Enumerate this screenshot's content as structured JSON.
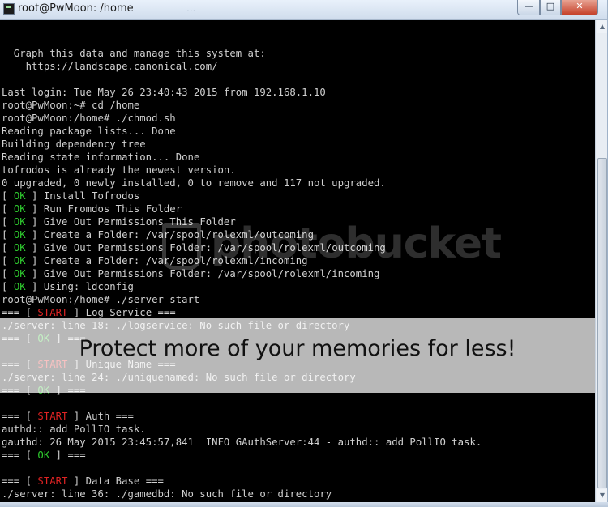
{
  "window": {
    "title": "root@PwMoon: /home",
    "title_ghost": "...",
    "buttons": {
      "minimize": "—",
      "maximize": "□",
      "close": "✕"
    }
  },
  "terminal": {
    "lines": [
      {
        "t": ""
      },
      {
        "t": "  Graph this data and manage this system at:"
      },
      {
        "t": "    https://landscape.canonical.com/"
      },
      {
        "t": ""
      },
      {
        "t": "Last login: Tue May 26 23:40:43 2015 from 192.168.1.10"
      },
      {
        "t": "root@PwMoon:~# cd /home"
      },
      {
        "t": "root@PwMoon:/home# ./chmod.sh"
      },
      {
        "t": "Reading package lists... Done"
      },
      {
        "t": "Building dependency tree"
      },
      {
        "t": "Reading state information... Done"
      },
      {
        "t": "tofrodos is already the newest version."
      },
      {
        "t": "0 upgraded, 0 newly installed, 0 to remove and 117 not upgraded."
      },
      {
        "pre": "[ ",
        "tag": "OK",
        "cls": "ok",
        "post": " ] Install Tofrodos"
      },
      {
        "pre": "[ ",
        "tag": "OK",
        "cls": "ok",
        "post": " ] Run Fromdos This Folder"
      },
      {
        "pre": "[ ",
        "tag": "OK",
        "cls": "ok",
        "post": " ] Give Out Permissions This Folder"
      },
      {
        "pre": "[ ",
        "tag": "OK",
        "cls": "ok",
        "post": " ] Create a Folder: /var/spool/rolexml/outcoming"
      },
      {
        "pre": "[ ",
        "tag": "OK",
        "cls": "ok",
        "post": " ] Give Out Permissions Folder: /var/spool/rolexml/outcoming"
      },
      {
        "pre": "[ ",
        "tag": "OK",
        "cls": "ok",
        "post": " ] Create a Folder: /var/spool/rolexml/incoming"
      },
      {
        "pre": "[ ",
        "tag": "OK",
        "cls": "ok",
        "post": " ] Give Out Permissions Folder: /var/spool/rolexml/incoming"
      },
      {
        "pre": "[ ",
        "tag": "OK",
        "cls": "ok",
        "post": " ] Using: ldconfig"
      },
      {
        "t": "root@PwMoon:/home# ./server start"
      },
      {
        "pre": "=== [ ",
        "tag": "START",
        "cls": "start",
        "post": " ] Log Service ==="
      },
      {
        "t": "./server: line 18: ./logservice: No such file or directory"
      },
      {
        "pre": "=== [ ",
        "tag": "OK",
        "cls": "ok",
        "post": " ] ==="
      },
      {
        "t": ""
      },
      {
        "pre": "=== [ ",
        "tag": "START",
        "cls": "start",
        "post": " ] Unique Name ==="
      },
      {
        "t": "./server: line 24: ./uniquenamed: No such file or directory"
      },
      {
        "pre": "=== [ ",
        "tag": "OK",
        "cls": "ok",
        "post": " ] ==="
      },
      {
        "t": ""
      },
      {
        "pre": "=== [ ",
        "tag": "START",
        "cls": "start",
        "post": " ] Auth ==="
      },
      {
        "t": "authd:: add PollIO task."
      },
      {
        "t": "gauthd: 26 May 2015 23:45:57,841  INFO GAuthServer:44 - authd:: add PollIO task."
      },
      {
        "pre": "=== [ ",
        "tag": "OK",
        "cls": "ok",
        "post": " ] ==="
      },
      {
        "t": ""
      },
      {
        "pre": "=== [ ",
        "tag": "START",
        "cls": "start",
        "post": " ] Data Base ==="
      },
      {
        "t": "./server: line 36: ./gamedbd: No such file or directory"
      },
      {
        "cursor": true
      }
    ]
  },
  "watermark": {
    "logo_text": "photobucket",
    "banner_text": "Protect more of your memories for less!"
  },
  "icons": {
    "window_icon": "terminal-icon",
    "scroll_up": "chevron-up-icon",
    "scroll_down": "chevron-down-icon"
  }
}
